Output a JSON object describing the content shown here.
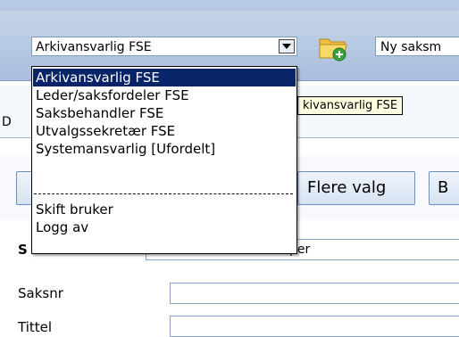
{
  "toolbar": {
    "role_select_value": "Arkivansvarlig FSE",
    "case_select_value": "Ny saksm"
  },
  "role_dropdown": {
    "items": [
      "Arkivansvarlig FSE",
      "Leder/saksfordeler FSE",
      "Saksbehandler FSE",
      "Utvalgssekretær FSE",
      "Systemansvarlig [Ufordelt]"
    ],
    "actions": [
      "Skift bruker",
      "Logg av"
    ],
    "selected_index": 0
  },
  "tooltip": "kivansvarlig FSE",
  "tabstrip": {
    "partial_text": "D"
  },
  "buttons": {
    "more_options": "Flere valg",
    "partial_right": "B"
  },
  "form": {
    "row1_label_partial": "S",
    "row1_value_partial": "per",
    "case_number_label": "Saksnr",
    "case_number_value": "",
    "title_label": "Tittel",
    "title_value": ""
  },
  "colors": {
    "selection": "#0a246a",
    "tooltip_bg": "#ffffe1",
    "toolbar_bg": "#b6c9e3"
  }
}
